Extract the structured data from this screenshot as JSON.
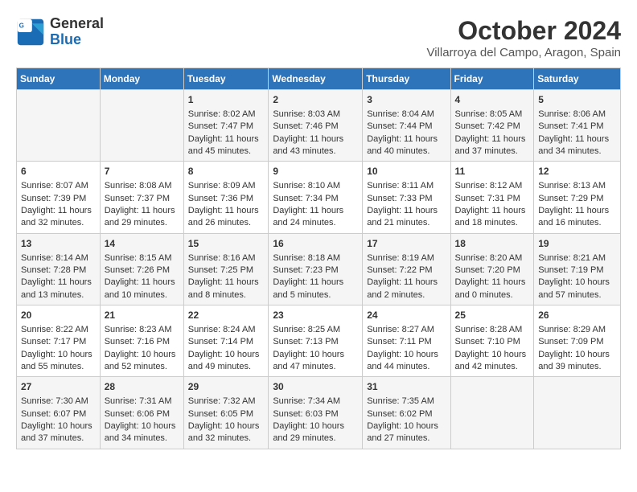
{
  "logo": {
    "line1": "General",
    "line2": "Blue"
  },
  "title": "October 2024",
  "subtitle": "Villarroya del Campo, Aragon, Spain",
  "days_of_week": [
    "Sunday",
    "Monday",
    "Tuesday",
    "Wednesday",
    "Thursday",
    "Friday",
    "Saturday"
  ],
  "weeks": [
    [
      {
        "day": "",
        "content": ""
      },
      {
        "day": "",
        "content": ""
      },
      {
        "day": "1",
        "content": "Sunrise: 8:02 AM\nSunset: 7:47 PM\nDaylight: 11 hours and 45 minutes."
      },
      {
        "day": "2",
        "content": "Sunrise: 8:03 AM\nSunset: 7:46 PM\nDaylight: 11 hours and 43 minutes."
      },
      {
        "day": "3",
        "content": "Sunrise: 8:04 AM\nSunset: 7:44 PM\nDaylight: 11 hours and 40 minutes."
      },
      {
        "day": "4",
        "content": "Sunrise: 8:05 AM\nSunset: 7:42 PM\nDaylight: 11 hours and 37 minutes."
      },
      {
        "day": "5",
        "content": "Sunrise: 8:06 AM\nSunset: 7:41 PM\nDaylight: 11 hours and 34 minutes."
      }
    ],
    [
      {
        "day": "6",
        "content": "Sunrise: 8:07 AM\nSunset: 7:39 PM\nDaylight: 11 hours and 32 minutes."
      },
      {
        "day": "7",
        "content": "Sunrise: 8:08 AM\nSunset: 7:37 PM\nDaylight: 11 hours and 29 minutes."
      },
      {
        "day": "8",
        "content": "Sunrise: 8:09 AM\nSunset: 7:36 PM\nDaylight: 11 hours and 26 minutes."
      },
      {
        "day": "9",
        "content": "Sunrise: 8:10 AM\nSunset: 7:34 PM\nDaylight: 11 hours and 24 minutes."
      },
      {
        "day": "10",
        "content": "Sunrise: 8:11 AM\nSunset: 7:33 PM\nDaylight: 11 hours and 21 minutes."
      },
      {
        "day": "11",
        "content": "Sunrise: 8:12 AM\nSunset: 7:31 PM\nDaylight: 11 hours and 18 minutes."
      },
      {
        "day": "12",
        "content": "Sunrise: 8:13 AM\nSunset: 7:29 PM\nDaylight: 11 hours and 16 minutes."
      }
    ],
    [
      {
        "day": "13",
        "content": "Sunrise: 8:14 AM\nSunset: 7:28 PM\nDaylight: 11 hours and 13 minutes."
      },
      {
        "day": "14",
        "content": "Sunrise: 8:15 AM\nSunset: 7:26 PM\nDaylight: 11 hours and 10 minutes."
      },
      {
        "day": "15",
        "content": "Sunrise: 8:16 AM\nSunset: 7:25 PM\nDaylight: 11 hours and 8 minutes."
      },
      {
        "day": "16",
        "content": "Sunrise: 8:18 AM\nSunset: 7:23 PM\nDaylight: 11 hours and 5 minutes."
      },
      {
        "day": "17",
        "content": "Sunrise: 8:19 AM\nSunset: 7:22 PM\nDaylight: 11 hours and 2 minutes."
      },
      {
        "day": "18",
        "content": "Sunrise: 8:20 AM\nSunset: 7:20 PM\nDaylight: 11 hours and 0 minutes."
      },
      {
        "day": "19",
        "content": "Sunrise: 8:21 AM\nSunset: 7:19 PM\nDaylight: 10 hours and 57 minutes."
      }
    ],
    [
      {
        "day": "20",
        "content": "Sunrise: 8:22 AM\nSunset: 7:17 PM\nDaylight: 10 hours and 55 minutes."
      },
      {
        "day": "21",
        "content": "Sunrise: 8:23 AM\nSunset: 7:16 PM\nDaylight: 10 hours and 52 minutes."
      },
      {
        "day": "22",
        "content": "Sunrise: 8:24 AM\nSunset: 7:14 PM\nDaylight: 10 hours and 49 minutes."
      },
      {
        "day": "23",
        "content": "Sunrise: 8:25 AM\nSunset: 7:13 PM\nDaylight: 10 hours and 47 minutes."
      },
      {
        "day": "24",
        "content": "Sunrise: 8:27 AM\nSunset: 7:11 PM\nDaylight: 10 hours and 44 minutes."
      },
      {
        "day": "25",
        "content": "Sunrise: 8:28 AM\nSunset: 7:10 PM\nDaylight: 10 hours and 42 minutes."
      },
      {
        "day": "26",
        "content": "Sunrise: 8:29 AM\nSunset: 7:09 PM\nDaylight: 10 hours and 39 minutes."
      }
    ],
    [
      {
        "day": "27",
        "content": "Sunrise: 7:30 AM\nSunset: 6:07 PM\nDaylight: 10 hours and 37 minutes."
      },
      {
        "day": "28",
        "content": "Sunrise: 7:31 AM\nSunset: 6:06 PM\nDaylight: 10 hours and 34 minutes."
      },
      {
        "day": "29",
        "content": "Sunrise: 7:32 AM\nSunset: 6:05 PM\nDaylight: 10 hours and 32 minutes."
      },
      {
        "day": "30",
        "content": "Sunrise: 7:34 AM\nSunset: 6:03 PM\nDaylight: 10 hours and 29 minutes."
      },
      {
        "day": "31",
        "content": "Sunrise: 7:35 AM\nSunset: 6:02 PM\nDaylight: 10 hours and 27 minutes."
      },
      {
        "day": "",
        "content": ""
      },
      {
        "day": "",
        "content": ""
      }
    ]
  ]
}
